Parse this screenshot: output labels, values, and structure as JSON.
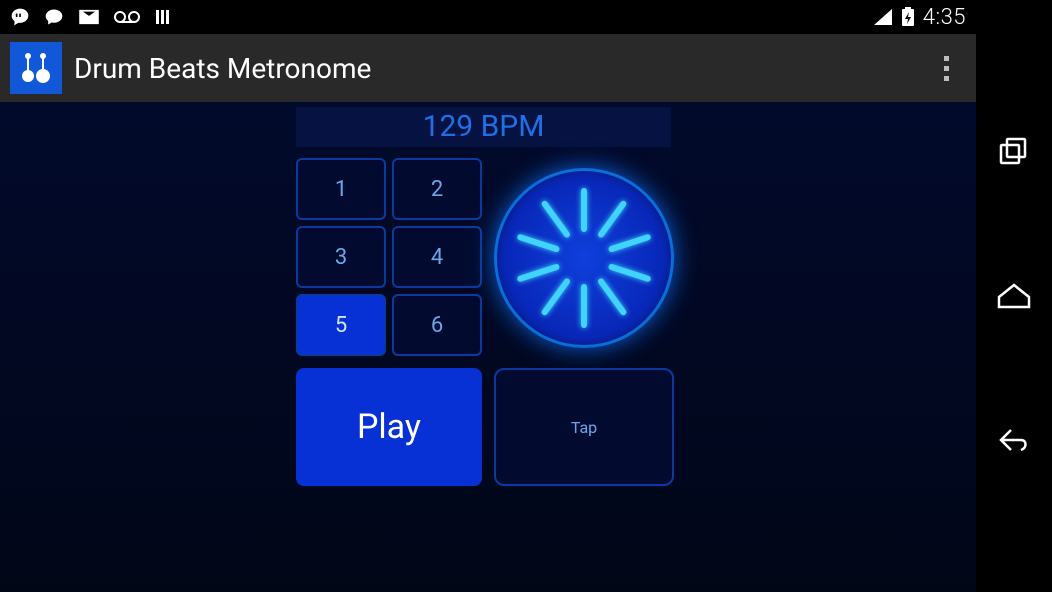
{
  "status": {
    "time": "4:35"
  },
  "actionbar": {
    "title": "Drum Beats Metronome"
  },
  "bpm_label": "129 BPM",
  "beats": {
    "b1": "1",
    "b2": "2",
    "b3": "3",
    "b4": "4",
    "b5": "5",
    "b6": "6",
    "active": 5
  },
  "play_label": "Play",
  "tap_label": "Tap"
}
